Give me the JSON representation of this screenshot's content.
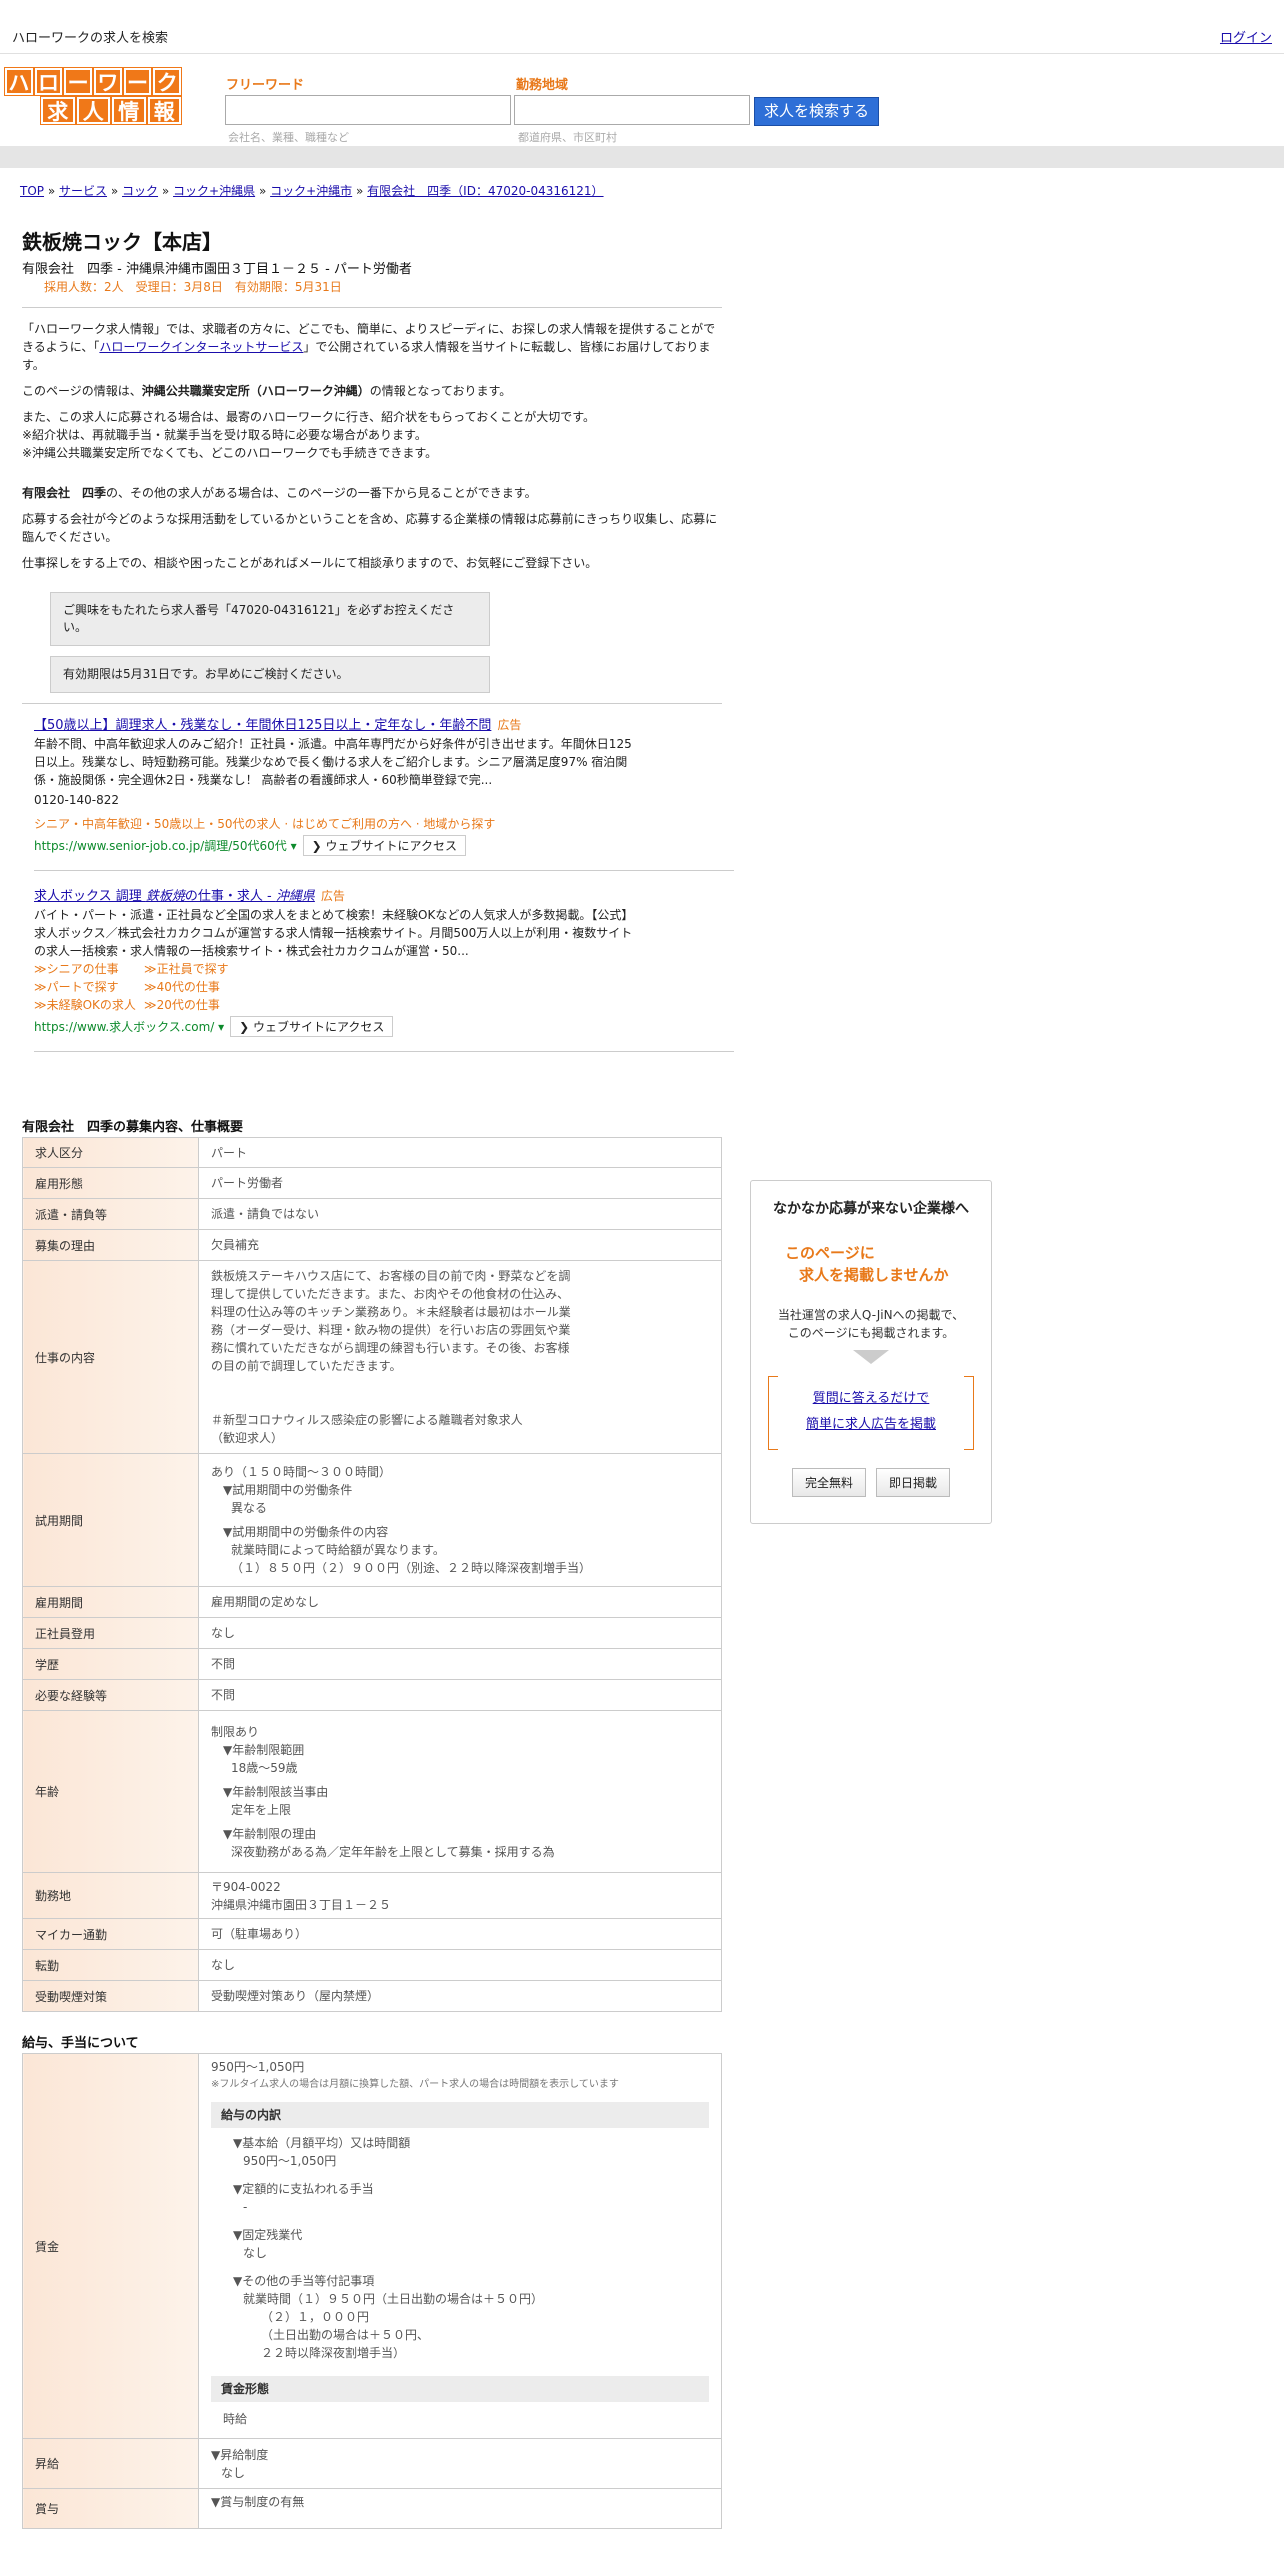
{
  "topbar": {
    "site_title": "ハローワークの求人を検索",
    "login": "ログイン"
  },
  "logo": {
    "row1": [
      "ハ",
      "ロ",
      "ー",
      "ワ",
      "ー",
      "ク"
    ],
    "row2": [
      "求",
      "人",
      "情",
      "報"
    ]
  },
  "search": {
    "freeword_label": "フリーワード",
    "freeword_hint": "会社名、業種、職種など",
    "area_label": "勤務地域",
    "area_hint": "都道府県、市区町村",
    "button": "求人を検索する"
  },
  "breadcrumb": [
    "TOP",
    "サービス",
    "コック",
    "コック+沖縄県",
    "コック+沖縄市",
    "有限会社　四季（ID：47020-04316121）"
  ],
  "breadcrumb_sep": "»",
  "job": {
    "title": "鉄板焼コック【本店】",
    "company_line": "有限会社　四季 - 沖縄県沖縄市園田３丁目１－２５ - パート労働者",
    "stats": "採用人数：2人　受理日：3月8日　有効期限：5月31日"
  },
  "intro": {
    "p1_a": "「ハローワーク求人情報」では、求職者の方々に、どこでも、簡単に、よりスピーディに、お探しの求人情報を提供することができるように、「",
    "p1_link": "ハローワークインターネットサービス",
    "p1_b": "」で公開されている求人情報を当サイトに転載し、皆様にお届けしております。",
    "p2_a": "このページの情報は、",
    "p2_bold": "沖縄公共職業安定所（ハローワーク沖縄）",
    "p2_b": "の情報となっております。",
    "p3_1": "また、この求人に応募される場合は、最寄のハローワークに行き、紹介状をもらっておくことが大切です。",
    "p3_2": "※紹介状は、再就職手当・就業手当を受け取る時に必要な場合があります。",
    "p3_3": "※沖縄公共職業安定所でなくても、どこのハローワークでも手続きできます。",
    "p4_bold": "有限会社　四季",
    "p4_b": "の、その他の求人がある場合は、このページの一番下から見ることができます。",
    "p5": "応募する会社が今どのような採用活動をしているかということを含め、応募する企業様の情報は応募前にきっちり収集し、応募に臨んでください。",
    "p6": "仕事探しをする上での、相談や困ったことがあればメールにて相談承りますので、お気軽にご登録下さい。"
  },
  "notices": {
    "n1": "ご興味をもたれたら求人番号「47020-04316121」を必ずお控えください。",
    "n2": "有効期限は5月31日です。お早めにご検討ください。"
  },
  "ads": [
    {
      "title": "【50歳以上】調理求人・残業なし・年間休日125日以上・定年なし・年齢不問",
      "tag": "広告",
      "desc": "年齢不問、中高年歓迎求人のみご紹介！正社員・派遣。中高年専門だから好条件が引き出せます。年間休日125日以上。残業なし、時短勤務可能。残業少なめで長く働ける求人をご紹介します。シニア層満足度97% 宿泊関係・施設関係・完全週休2日・残業なし！ 高齢者の看護師求人・60秒簡単登録で完...",
      "phone": "0120-140-822",
      "orange": "シニア・中高年歓迎・50歳以上・50代の求人 · はじめてご利用の方へ · 地域から探す",
      "url": "https://www.senior-job.co.jp/調理/50代60代",
      "button": "ウェブサイトにアクセス"
    },
    {
      "title_a": "求人ボックス 調理 ",
      "title_b": "鉄板焼",
      "title_c": "の仕事・求人 - ",
      "title_d": "沖縄県",
      "tag": "広告",
      "desc": "バイト・パート・派遣・正社員など全国の求人をまとめて検索！未経験OKなどの人気求人が多数掲載。【公式】求人ボックス／株式会社カカクコムが運営する求人情報一括検索サイト。月間500万人以上が利用・複数サイトの求人一括検索・求人情報の一括検索サイト・株式会社カカクコムが運営・50...",
      "sitelinks": [
        "≫シニアの仕事",
        "≫正社員で探す",
        "≫パートで探す",
        "≫40代の仕事",
        "≫未経験OKの求人",
        "≫20代の仕事"
      ],
      "url": "https://www.求人ボックス.com/",
      "button": "ウェブサイトにアクセス"
    }
  ],
  "summary": {
    "title": "有限会社　四季の募集内容、仕事概要",
    "rows": [
      {
        "label": "求人区分",
        "value": "パート"
      },
      {
        "label": "雇用形態",
        "value": "パート労働者"
      },
      {
        "label": "派遣・請負等",
        "value": "派遣・請負ではない"
      },
      {
        "label": "募集の理由",
        "value": "欠員補充"
      }
    ],
    "job_content_label": "仕事の内容",
    "job_content": [
      "鉄板焼ステーキハウス店にて、お客様の目の前で肉・野菜などを調",
      "理して提供していただきます。また、お肉やその他食材の仕込み、",
      "料理の仕込み等のキッチン業務あり。＊未経験者は最初はホール業",
      "務（オーダー受け、料理・飲み物の提供）を行いお店の雰囲気や業",
      "務に慣れていただきながら調理の練習も行います。その後、お客様",
      "の目の前で調理していただきます。",
      "",
      "",
      "＃新型コロナウィルス感染症の影響による離職者対象求人",
      "（歓迎求人）"
    ],
    "trial_label": "試用期間",
    "trial": {
      "line1": "あり（１５０時間～３００時間）",
      "h1": "▼試用期間中の労働条件",
      "v1": "異なる",
      "h2": "▼試用期間中の労働条件の内容",
      "v2a": "就業時間によって時給額が異なります。",
      "v2b": "（１）８５０円（２）９００円（別途、２２時以降深夜割増手当）"
    },
    "rows2": [
      {
        "label": "雇用期間",
        "value": "雇用期間の定めなし"
      },
      {
        "label": "正社員登用",
        "value": "なし"
      },
      {
        "label": "学歴",
        "value": "不問"
      },
      {
        "label": "必要な経験等",
        "value": "不問"
      }
    ],
    "age_label": "年齢",
    "age": {
      "line1": "制限あり",
      "h1": "▼年齢制限範囲",
      "v1": "18歳～59歳",
      "h2": "▼年齢制限該当事由",
      "v2": "定年を上限",
      "h3": "▼年齢制限の理由",
      "v3": "深夜勤務がある為／定年年齢を上限として募集・採用する為"
    },
    "location_label": "勤務地",
    "location_zip": "〒904-0022",
    "location_addr": "沖縄県沖縄市園田３丁目１－２５",
    "rows3": [
      {
        "label": "マイカー通勤",
        "value": "可（駐車場あり）"
      },
      {
        "label": "転勤",
        "value": "なし"
      },
      {
        "label": "受動喫煙対策",
        "value": "受動喫煙対策あり（屋内禁煙）"
      }
    ]
  },
  "salary": {
    "title": "給与、手当について",
    "label": "賃金",
    "amount": "950円〜1,050円",
    "note": "※フルタイム求人の場合は月額に換算した額、パート求人の場合は時間額を表示しています",
    "breakdown_label": "給与の内訳",
    "h1": "▼基本給（月額平均）又は時間額",
    "v1": "950円〜1,050円",
    "h2": "▼定額的に支払われる手当",
    "v2": "-",
    "h3": "▼固定残業代",
    "v3": "なし",
    "h4": "▼その他の手当等付記事項",
    "v4a": "就業時間（１）９５０円（土日出勤の場合は＋５０円）",
    "v4b": "（２）１，０００円",
    "v4c": "（土日出勤の場合は＋５０円、",
    "v4d": "２２時以降深夜割増手当）",
    "form_label": "賃金形態",
    "form_value": "時給",
    "raise_label": "昇給",
    "raise_h": "▼昇給制度",
    "raise_v": "なし",
    "bonus_label": "賞与",
    "bonus_h": "▼賞与制度の有無"
  },
  "sidebox": {
    "title": "なかなか応募が来ない企業様へ",
    "catch1": "このページに",
    "catch2": "求人を掲載しませんか",
    "desc1": "当社運営の求人Q-JiNへの掲載で、",
    "desc2": "このページにも掲載されます。",
    "link1": "質問に答えるだけで",
    "link2": "簡単に求人広告を掲載",
    "btn1": "完全無料",
    "btn2": "即日掲載"
  }
}
